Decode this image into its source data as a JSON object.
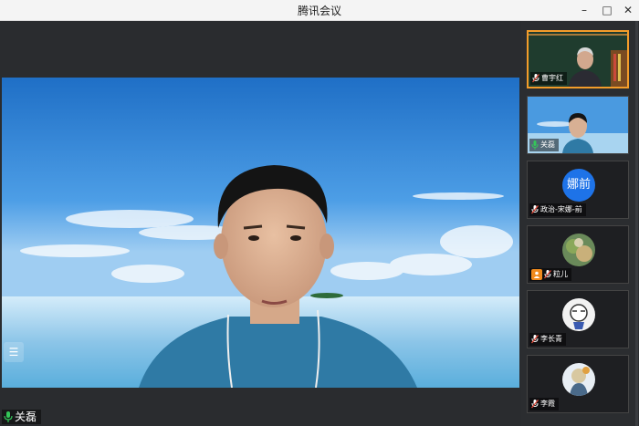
{
  "window": {
    "title": "腾讯会议",
    "minimize_label": "–",
    "maximize_label": "□",
    "close_label": "✕"
  },
  "main_video": {
    "speaker_name": "关磊",
    "menu_icon": "list-icon"
  },
  "participants": [
    {
      "name": "曹宇红",
      "mic": "muted"
    },
    {
      "name": "关磊",
      "mic": "active"
    },
    {
      "name": "政治-宋娜-前",
      "mic": "muted",
      "avatar_text": "娜前",
      "avatar_color": "#1e73e8"
    },
    {
      "name": "粒儿",
      "mic": "muted"
    },
    {
      "name": "李长青",
      "mic": "muted"
    },
    {
      "name": "李霞",
      "mic": "muted"
    }
  ],
  "colors": {
    "active_border": "#f39c2a",
    "mic_active": "#34c759",
    "mic_muted": "#e24a3a"
  }
}
